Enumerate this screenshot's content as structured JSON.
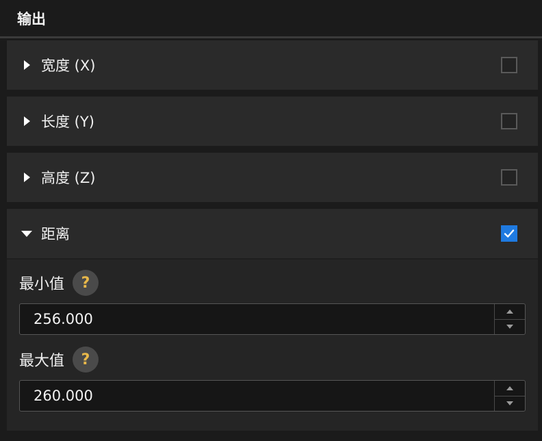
{
  "header": {
    "title": "输出"
  },
  "sections": [
    {
      "label": "宽度 (X)",
      "checked": false,
      "expanded": false
    },
    {
      "label": "长度 (Y)",
      "checked": false,
      "expanded": false
    },
    {
      "label": "高度 (Z)",
      "checked": false,
      "expanded": false
    },
    {
      "label": "距离",
      "checked": true,
      "expanded": true
    }
  ],
  "distance": {
    "min": {
      "label": "最小值",
      "help": "?",
      "value": "256.000"
    },
    "max": {
      "label": "最大值",
      "help": "?",
      "value": "260.000"
    }
  },
  "colors": {
    "accent": "#1f7ae0",
    "help_mark": "#e8b84a",
    "background": "#1b1b1b"
  },
  "icons": {
    "collapsed": "caret-right-icon",
    "expanded": "caret-down-icon",
    "check": "checkmark-icon",
    "help": "question-icon",
    "increment": "chevron-up-icon",
    "decrement": "chevron-down-icon"
  }
}
